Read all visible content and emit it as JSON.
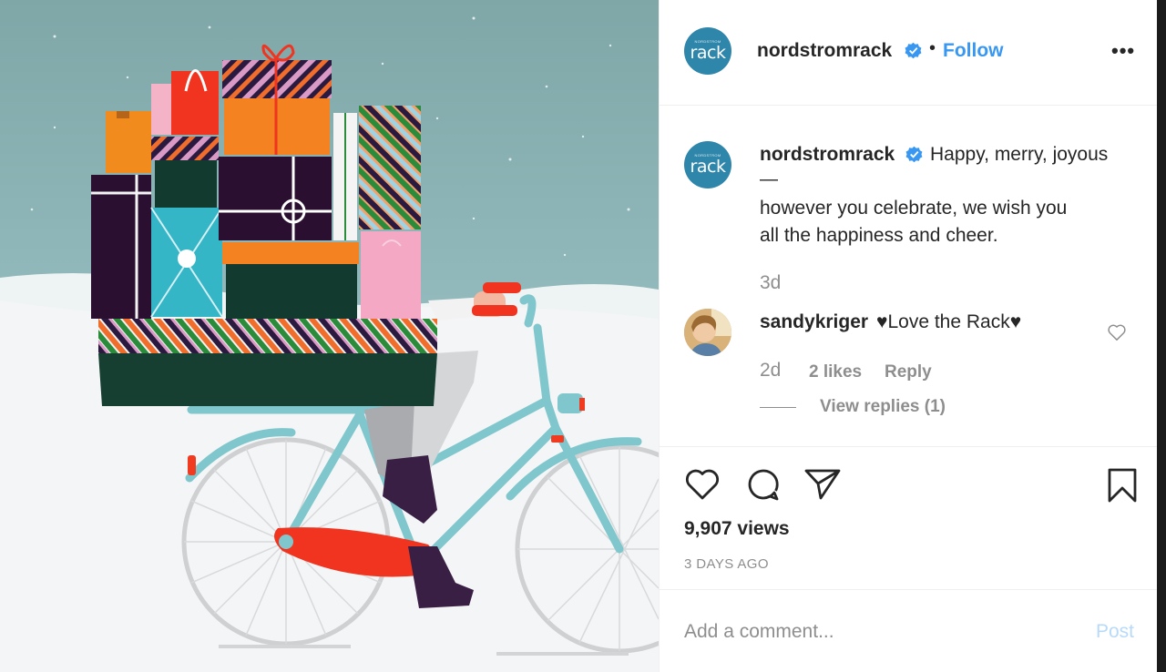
{
  "post": {
    "author": "nordstromrack",
    "follow_label": "Follow",
    "separator": "•",
    "more_label": "•••",
    "avatar_logo_small": "NORDSTROM",
    "avatar_logo_big": "rack"
  },
  "caption": {
    "username": "nordstromrack",
    "line1": "Happy, merry, joyous",
    "dash": "—",
    "line2": "however you celebrate, we wish you",
    "line3": "all the happiness and cheer.",
    "time": "3d"
  },
  "comment": {
    "username": "sandykriger",
    "text": "♥Love the Rack♥",
    "time": "2d",
    "likes": "2 likes",
    "reply_label": "Reply",
    "view_replies": "View replies (1)"
  },
  "stats": {
    "views": "9,907 views",
    "date": "3 DAYS AGO"
  },
  "composer": {
    "placeholder": "Add a comment...",
    "post_label": "Post"
  },
  "colors": {
    "accent": "#3897f0",
    "verified": "#3897f0",
    "muted": "#8e8e8e",
    "post_disabled": "#b8dafa",
    "brand_avatar": "#2e86ab"
  },
  "icons": {
    "verified": "verified-badge-icon",
    "like": "heart-icon",
    "comment": "comment-bubble-icon",
    "share": "paper-plane-icon",
    "save": "bookmark-icon",
    "comment_like": "small-heart-icon"
  }
}
